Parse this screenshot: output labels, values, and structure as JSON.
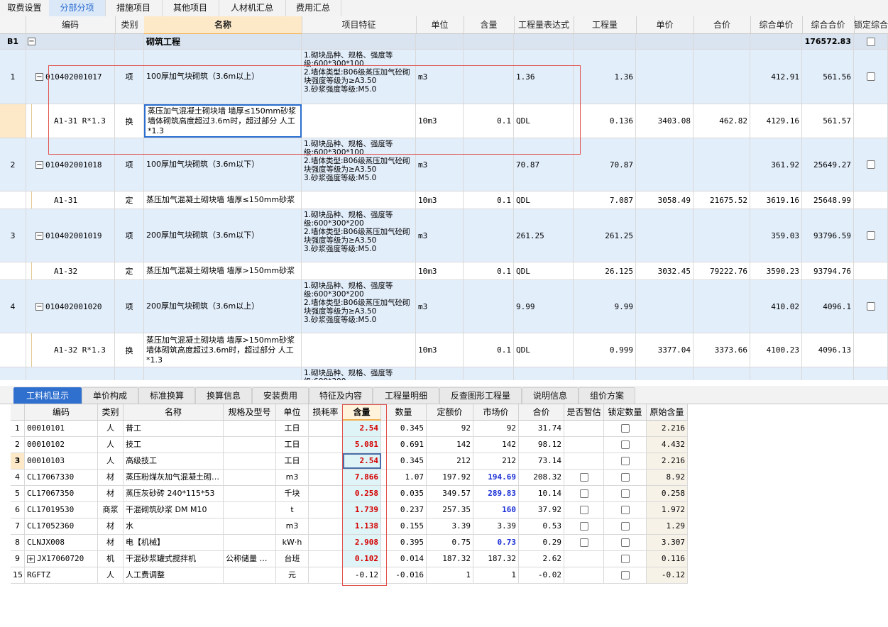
{
  "top_tabs": [
    "取费设置",
    "分部分项",
    "措施项目",
    "其他项目",
    "人材机汇总",
    "费用汇总"
  ],
  "upper_headers": [
    "编码",
    "类别",
    "名称",
    "项目特征",
    "单位",
    "含量",
    "工程量表达式",
    "工程量",
    "单价",
    "合价",
    "综合单价",
    "综合合价",
    "锁定综合"
  ],
  "group_row": {
    "id": "B1",
    "toggle": "−",
    "name": "砌筑工程",
    "total": "176572.83"
  },
  "rows": [
    {
      "num": "1",
      "code": "010402001017",
      "type": "项",
      "name": "100厚加气块砌筑（3.6m以上）",
      "feature": "1.砌块品种、规格、强度等级:600*300*100\n2.墙体类型:B06级蒸压加气砼砌块强度等级为≥A3.50\n3.砂浆强度等级:M5.0",
      "unit": "m3",
      "content": "",
      "expr": "1.36",
      "qty": "1.36",
      "price": "",
      "sum": "",
      "uprice": "412.91",
      "usum": "561.56"
    },
    {
      "num": "",
      "code": "A1-31 R*1.3",
      "type": "换",
      "name": "蒸压加气混凝土砌块墙 墙厚≤150mm砂浆 墙体砌筑高度超过3.6m时，超过部分 人工*1.3",
      "feature": "",
      "unit": "10m3",
      "content": "0.1",
      "expr": "QDL",
      "qty": "0.136",
      "price": "3403.08",
      "sum": "462.82",
      "uprice": "4129.16",
      "usum": "561.57"
    },
    {
      "num": "2",
      "code": "010402001018",
      "type": "项",
      "name": "100厚加气块砌筑（3.6m以下）",
      "feature": "1.砌块品种、规格、强度等级:600*300*100\n2.墙体类型:B06级蒸压加气砼砌块强度等级为≥A3.50\n3.砂浆强度等级:M5.0",
      "unit": "m3",
      "content": "",
      "expr": "70.87",
      "qty": "70.87",
      "price": "",
      "sum": "",
      "uprice": "361.92",
      "usum": "25649.27"
    },
    {
      "num": "",
      "code": "A1-31",
      "type": "定",
      "name": "蒸压加气混凝土砌块墙 墙厚≤150mm砂浆",
      "feature": "",
      "unit": "10m3",
      "content": "0.1",
      "expr": "QDL",
      "qty": "7.087",
      "price": "3058.49",
      "sum": "21675.52",
      "uprice": "3619.16",
      "usum": "25648.99"
    },
    {
      "num": "3",
      "code": "010402001019",
      "type": "项",
      "name": "200厚加气块砌筑（3.6m以下）",
      "feature": "1.砌块品种、规格、强度等级:600*300*200\n2.墙体类型:B06级蒸压加气砼砌块强度等级为≥A3.50\n3.砂浆强度等级:M5.0",
      "unit": "m3",
      "content": "",
      "expr": "261.25",
      "qty": "261.25",
      "price": "",
      "sum": "",
      "uprice": "359.03",
      "usum": "93796.59"
    },
    {
      "num": "",
      "code": "A1-32",
      "type": "定",
      "name": "蒸压加气混凝土砌块墙 墙厚>150mm砂浆",
      "feature": "",
      "unit": "10m3",
      "content": "0.1",
      "expr": "QDL",
      "qty": "26.125",
      "price": "3032.45",
      "sum": "79222.76",
      "uprice": "3590.23",
      "usum": "93794.76"
    },
    {
      "num": "4",
      "code": "010402001020",
      "type": "项",
      "name": "200厚加气块砌筑（3.6m以上）",
      "feature": "1.砌块品种、规格、强度等级:600*300*200\n2.墙体类型:B06级蒸压加气砼砌块强度等级为≥A3.50\n3.砂浆强度等级:M5.0",
      "unit": "m3",
      "content": "",
      "expr": "9.99",
      "qty": "9.99",
      "price": "",
      "sum": "",
      "uprice": "410.02",
      "usum": "4096.1"
    },
    {
      "num": "",
      "code": "A1-32 R*1.3",
      "type": "换",
      "name": "蒸压加气混凝土砌块墙 墙厚>150mm砂浆 墙体砌筑高度超过3.6m时，超过部分 人工*1.3",
      "feature": "",
      "unit": "10m3",
      "content": "0.1",
      "expr": "QDL",
      "qty": "0.999",
      "price": "3377.04",
      "sum": "3373.66",
      "uprice": "4100.23",
      "usum": "4096.13"
    },
    {
      "num": "",
      "code": "",
      "type": "",
      "name": "",
      "feature": "1.砌块品种、规格、强度等级:600*300",
      "unit": "",
      "content": "",
      "expr": "",
      "qty": "",
      "price": "",
      "sum": "",
      "uprice": "",
      "usum": ""
    }
  ],
  "bottom_tabs": [
    "工料机显示",
    "单价构成",
    "标准换算",
    "换算信息",
    "安装费用",
    "特征及内容",
    "工程量明细",
    "反查图形工程量",
    "说明信息",
    "组价方案"
  ],
  "lower_headers": [
    "",
    "编码",
    "类别",
    "名称",
    "规格及型号",
    "单位",
    "损耗率",
    "含量",
    "数量",
    "定额价",
    "市场价",
    "合价",
    "是否暂估",
    "锁定数量",
    "原始含量"
  ],
  "lower_rows": [
    {
      "n": "1",
      "code": "00010101",
      "type": "人",
      "name": "普工",
      "spec": "",
      "unit": "工日",
      "loss": "",
      "content": "2.54",
      "qty": "0.345",
      "price": "92",
      "market": "92",
      "sum": "31.74",
      "est": false,
      "lock": true,
      "orig": "2.216",
      "blue": false
    },
    {
      "n": "2",
      "code": "00010102",
      "type": "人",
      "name": "技工",
      "spec": "",
      "unit": "工日",
      "loss": "",
      "content": "5.081",
      "qty": "0.691",
      "price": "142",
      "market": "142",
      "sum": "98.12",
      "est": false,
      "lock": true,
      "orig": "4.432",
      "blue": false
    },
    {
      "n": "3",
      "code": "00010103",
      "type": "人",
      "name": "高级技工",
      "spec": "",
      "unit": "工日",
      "loss": "",
      "content": "2.54",
      "qty": "0.345",
      "price": "212",
      "market": "212",
      "sum": "73.14",
      "est": false,
      "lock": true,
      "orig": "2.216",
      "blue": false
    },
    {
      "n": "4",
      "code": "CL17067330",
      "type": "材",
      "name": "蒸压粉煤灰加气混凝土砌…",
      "spec": "",
      "unit": "m3",
      "loss": "",
      "content": "7.866",
      "qty": "1.07",
      "price": "197.92",
      "market": "194.69",
      "sum": "208.32",
      "est": true,
      "lock": true,
      "orig": "8.92",
      "blue": true
    },
    {
      "n": "5",
      "code": "CL17067350",
      "type": "材",
      "name": "蒸压灰砂砖 240*115*53",
      "spec": "",
      "unit": "千块",
      "loss": "",
      "content": "0.258",
      "qty": "0.035",
      "price": "349.57",
      "market": "289.83",
      "sum": "10.14",
      "est": true,
      "lock": true,
      "orig": "0.258",
      "blue": true
    },
    {
      "n": "6",
      "code": "CL17019530",
      "type": "商浆",
      "name": "干混砌筑砂浆 DM M10",
      "spec": "",
      "unit": "t",
      "loss": "",
      "content": "1.739",
      "qty": "0.237",
      "price": "257.35",
      "market": "160",
      "sum": "37.92",
      "est": true,
      "lock": true,
      "orig": "1.972",
      "blue": true
    },
    {
      "n": "7",
      "code": "CL17052360",
      "type": "材",
      "name": "水",
      "spec": "",
      "unit": "m3",
      "loss": "",
      "content": "1.138",
      "qty": "0.155",
      "price": "3.39",
      "market": "3.39",
      "sum": "0.53",
      "est": true,
      "lock": true,
      "orig": "1.29",
      "blue": false
    },
    {
      "n": "8",
      "code": "CLNJX008",
      "type": "材",
      "name": "电【机械】",
      "spec": "",
      "unit": "kW·h",
      "loss": "",
      "content": "2.908",
      "qty": "0.395",
      "price": "0.75",
      "market": "0.73",
      "sum": "0.29",
      "est": true,
      "lock": true,
      "orig": "3.307",
      "blue": true
    },
    {
      "n": "9",
      "code": "JX17060720",
      "type": "机",
      "name": "干混砂浆罐式搅拌机",
      "spec": "公称储量 …",
      "unit": "台班",
      "loss": "",
      "content": "0.102",
      "qty": "0.014",
      "price": "187.32",
      "market": "187.32",
      "sum": "2.62",
      "est": false,
      "lock": true,
      "orig": "0.116",
      "blue": false,
      "expand": "+"
    },
    {
      "n": "15",
      "code": "RGFTZ",
      "type": "人",
      "name": "人工费调整",
      "spec": "",
      "unit": "元",
      "loss": "",
      "content": "-0.12",
      "qty": "-0.016",
      "price": "1",
      "market": "1",
      "sum": "-0.02",
      "est": false,
      "lock": true,
      "orig": "-0.12",
      "blue": false,
      "plain": true
    }
  ]
}
